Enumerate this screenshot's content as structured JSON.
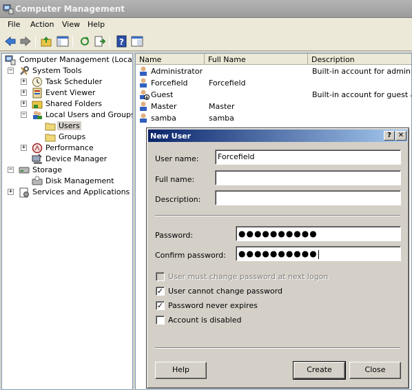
{
  "window": {
    "title": "Computer Management"
  },
  "menu": [
    "File",
    "Action",
    "View",
    "Help"
  ],
  "toolbar": {
    "buttons": [
      "back-icon",
      "forward-icon",
      "up-folder-icon",
      "show-hide-tree-icon",
      "refresh-icon",
      "export-list-icon",
      "help-icon",
      "properties-icon"
    ]
  },
  "tree": {
    "items": [
      {
        "label": "Computer Management (Local)",
        "expander": ""
      },
      {
        "label": "System Tools",
        "expander": "−"
      },
      {
        "label": "Task Scheduler",
        "expander": "+"
      },
      {
        "label": "Event Viewer",
        "expander": "+"
      },
      {
        "label": "Shared Folders",
        "expander": "+"
      },
      {
        "label": "Local Users and Groups",
        "expander": "−"
      },
      {
        "label": "Users",
        "expander": ""
      },
      {
        "label": "Groups",
        "expander": ""
      },
      {
        "label": "Performance",
        "expander": "+"
      },
      {
        "label": "Device Manager",
        "expander": ""
      },
      {
        "label": "Storage",
        "expander": "−"
      },
      {
        "label": "Disk Management",
        "expander": ""
      },
      {
        "label": "Services and Applications",
        "expander": "+"
      }
    ]
  },
  "list": {
    "columns": [
      "Name",
      "Full Name",
      "Description"
    ],
    "rows": [
      {
        "name": "Administrator",
        "full_name": "",
        "description": "Built-in account for administering"
      },
      {
        "name": "Forcefield",
        "full_name": "Forcefield",
        "description": ""
      },
      {
        "name": "Guest",
        "full_name": "",
        "description": "Built-in account for guest acce"
      },
      {
        "name": "Master",
        "full_name": "Master",
        "description": ""
      },
      {
        "name": "samba",
        "full_name": "samba",
        "description": ""
      }
    ]
  },
  "dialog": {
    "title": "New User",
    "help_caption": "?",
    "close_caption": "✕",
    "user_name_label": "User name:",
    "user_name_value": "Forcefield",
    "full_name_label": "Full name:",
    "full_name_value": "",
    "description_label": "Description:",
    "description_value": "",
    "password_label": "Password:",
    "password_value": "●●●●●●●●●●",
    "confirm_label": "Confirm password:",
    "confirm_value": "●●●●●●●●●●",
    "checkboxes": [
      {
        "label": "User must change password at next logon",
        "checked": false,
        "disabled": true
      },
      {
        "label": "User cannot change password",
        "checked": true,
        "disabled": false
      },
      {
        "label": "Password never expires",
        "checked": true,
        "disabled": false
      },
      {
        "label": "Account is disabled",
        "checked": false,
        "disabled": false
      }
    ],
    "buttons": {
      "help": "Help",
      "create": "Create",
      "close": "Close"
    }
  }
}
